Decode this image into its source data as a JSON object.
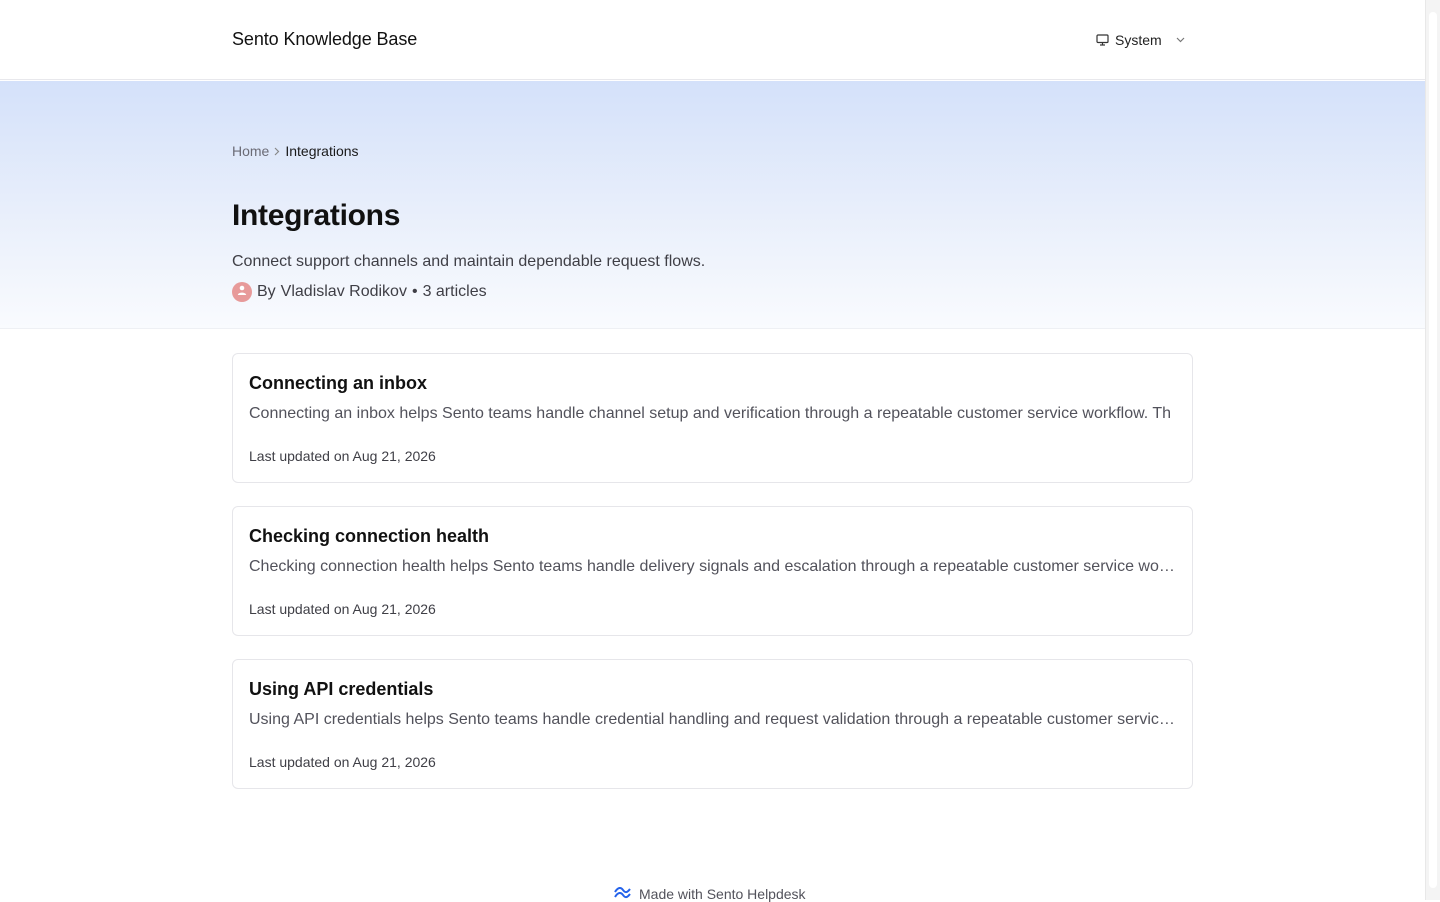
{
  "header": {
    "brand": "Sento Knowledge Base",
    "theme_label": "System",
    "theme_icon": "monitor-icon"
  },
  "breadcrumb": {
    "home": "Home",
    "current": "Integrations"
  },
  "category": {
    "title": "Integrations",
    "description": "Connect support channels and maintain dependable request flows.",
    "author_prefix": "By",
    "author": "Vladislav Rodikov",
    "separator": "•",
    "article_count": "3 articles"
  },
  "articles": [
    {
      "title": "Connecting an inbox",
      "excerpt": "Connecting an inbox helps Sento teams handle channel setup and verification through a repeatable customer service workflow. Th",
      "updated": "Last updated on Aug 21, 2026"
    },
    {
      "title": "Checking connection health",
      "excerpt": "Checking connection health helps Sento teams handle delivery signals and escalation through a repeatable customer service workflow.",
      "updated": "Last updated on Aug 21, 2026"
    },
    {
      "title": "Using API credentials",
      "excerpt": "Using API credentials helps Sento teams handle credential handling and request validation through a repeatable customer service workflow.",
      "updated": "Last updated on Aug 21, 2026"
    }
  ],
  "footer": {
    "label": "Made with Sento Helpdesk",
    "logo_icon": "sento-logo-icon"
  },
  "colors": {
    "hero_top": "#d4e1fa",
    "hero_bottom": "#f9fbfe",
    "avatar": "#e79a9a",
    "logo": "#2563eb"
  }
}
